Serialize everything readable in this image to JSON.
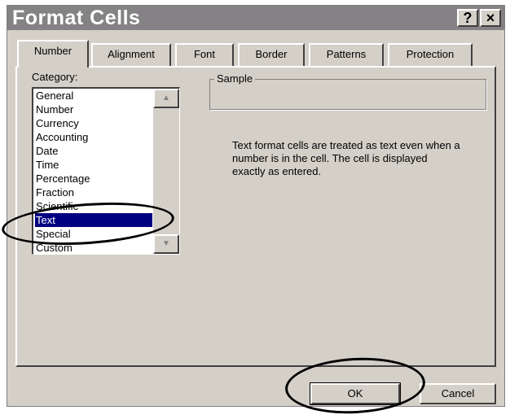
{
  "dialog": {
    "title": "Format Cells",
    "help_button": "?",
    "close_button": "×"
  },
  "tabs": [
    {
      "label": "Number",
      "active": true
    },
    {
      "label": "Alignment",
      "active": false
    },
    {
      "label": "Font",
      "active": false
    },
    {
      "label": "Border",
      "active": false
    },
    {
      "label": "Patterns",
      "active": false
    },
    {
      "label": "Protection",
      "active": false
    }
  ],
  "category": {
    "label": "Category:",
    "items": [
      "General",
      "Number",
      "Currency",
      "Accounting",
      "Date",
      "Time",
      "Percentage",
      "Fraction",
      "Scientific",
      "Text",
      "Special",
      "Custom"
    ],
    "selected": "Text"
  },
  "sample": {
    "label": "Sample"
  },
  "description": "Text format cells are treated as text even when a number is in the cell.  The cell is displayed exactly as entered.",
  "buttons": {
    "ok": "OK",
    "cancel": "Cancel"
  },
  "colors": {
    "dialog_bg": "#d4d0c8",
    "titlebar_bg": "#848284",
    "selection_bg": "#000080"
  }
}
